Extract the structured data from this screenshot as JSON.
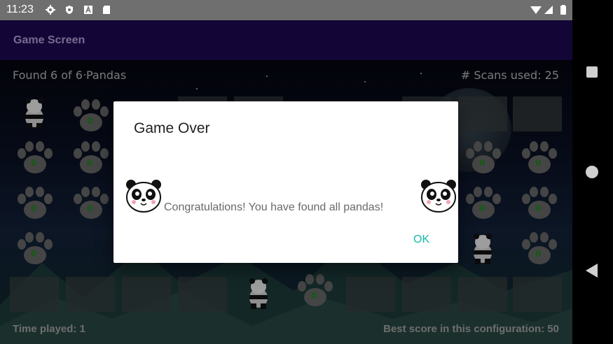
{
  "status_bar": {
    "time": "11:23",
    "left_icons": [
      "settings-icon",
      "shield-icon",
      "a-icon",
      "sd-card-icon"
    ],
    "right_icons": [
      "wifi-icon",
      "signal-icon",
      "battery-icon"
    ]
  },
  "app_bar": {
    "title": "Game Screen"
  },
  "game": {
    "found_text": "Found 6 of 6 Pandas",
    "scans_text": "# Scans used: 25",
    "time_played": "Time played: 1",
    "best_score": "Best score in this configuration: 50",
    "paw_number": "0"
  },
  "dialog": {
    "title": "Game Over",
    "message": "Congratulations! You have found all pandas!",
    "ok_label": "OK"
  },
  "nav_bar": {
    "icons": [
      "recents-icon",
      "home-icon",
      "back-icon"
    ]
  },
  "colors": {
    "app_bar": "#1e0a55",
    "accent": "#14b8a6"
  }
}
